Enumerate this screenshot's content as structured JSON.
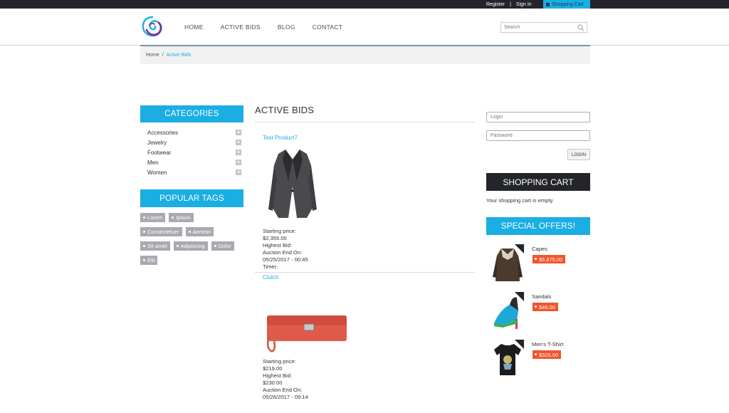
{
  "topbar": {
    "register": "Register",
    "separator": "|",
    "sign_in": "Sign In",
    "cart": "Shopping Cart"
  },
  "nav": [
    "HOME",
    "ACTIVE BIDS",
    "BLOG",
    "CONTACT"
  ],
  "search": {
    "placeholder": "Search"
  },
  "breadcrumb": {
    "home": "Home",
    "separator": "/",
    "current": "Active Bids"
  },
  "categories": {
    "title": "CATEGORIES",
    "items": [
      "Accessories",
      "Jewelry",
      "Footwear",
      "Men",
      "Women"
    ],
    "toggle_symbol": "+"
  },
  "tags": {
    "title": "POPULAR TAGS",
    "items": [
      "Lorem",
      "Ipsum",
      "Consectetuer",
      "Aenean",
      "Sit amet",
      "Adipiscing",
      "Dolor",
      "Elit"
    ]
  },
  "active_bids": {
    "title": "ACTIVE BIDS",
    "products": [
      {
        "name": "Test Product7",
        "starting_label": "Starting price:",
        "starting": "$2,355.00",
        "highest_label": "Highest Bid:",
        "auction_label": "Auction End On:",
        "auction_end": "05/25/2017 - 00:45",
        "timer_label": "Timer:"
      },
      {
        "name": "Clutch",
        "starting_label": "Starting price:",
        "starting": "$219.00",
        "highest_label": "Highest Bid:",
        "highest": "$230.00",
        "auction_label": "Auction End On:",
        "auction_end": "05/26/2017 - 09:14"
      }
    ]
  },
  "login": {
    "login_placeholder": "Login",
    "password_placeholder": "Password",
    "button": "LOGIN"
  },
  "cart": {
    "title": "SHOPPING CART",
    "empty_text": "Your shopping cart is empty."
  },
  "offers": {
    "title": "SPECIAL OFFERS!",
    "items": [
      {
        "name": "Capes",
        "price": "$5,875.00"
      },
      {
        "name": "Sandals",
        "price": "$46.00"
      },
      {
        "name": "Men's T-Shirt",
        "price": "$320.00"
      }
    ]
  },
  "colors": {
    "accent": "#1aaee3",
    "dark": "#23252b",
    "price_badge": "#f2542d",
    "tag": "#a8aab0"
  }
}
